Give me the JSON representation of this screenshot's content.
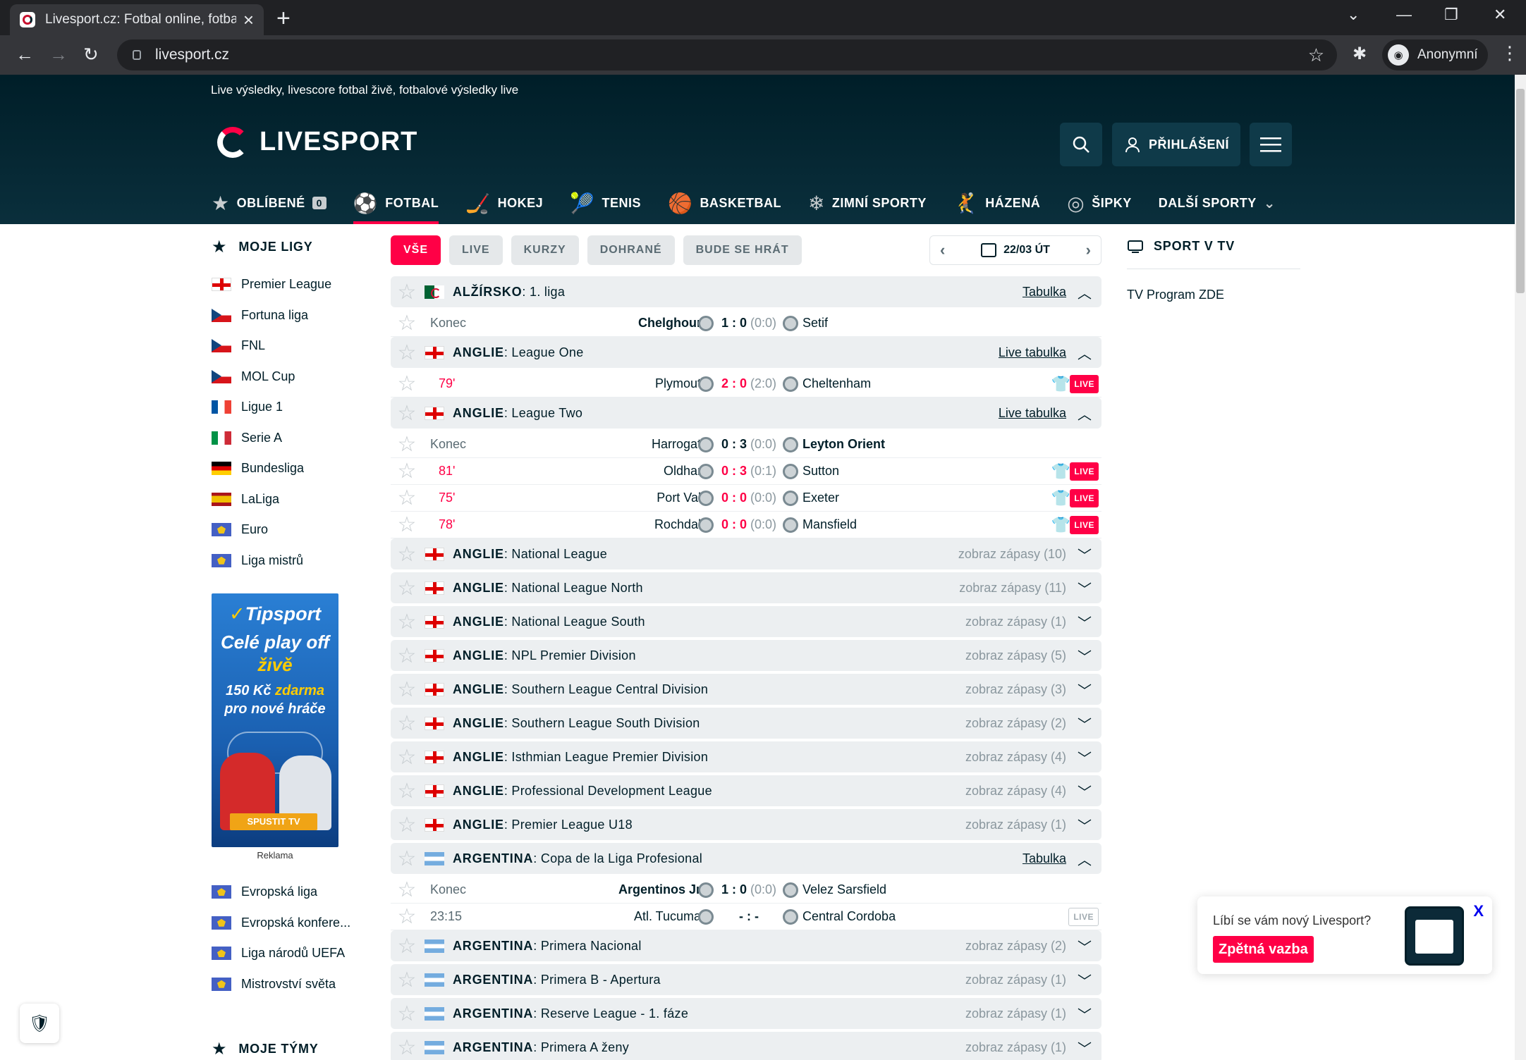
{
  "browser": {
    "tab_title": "Livesport.cz: Fotbal online, fotbal",
    "url": "livesport.cz",
    "profile": "Anonymní"
  },
  "site": {
    "tagline": "Live výsledky, livescore fotbal živě, fotbalové výsledky live",
    "logo_text": "LIVESPORT",
    "login": "PŘIHLÁŠENÍ",
    "brand_color": "#ff0046"
  },
  "sports_nav": [
    {
      "label": "OBLÍBENÉ",
      "icon": "star-icon",
      "count": "0"
    },
    {
      "label": "FOTBAL",
      "icon": "football-icon",
      "active": true
    },
    {
      "label": "HOKEJ",
      "icon": "hockey-icon"
    },
    {
      "label": "TENIS",
      "icon": "tennis-icon"
    },
    {
      "label": "BASKETBAL",
      "icon": "basketball-icon"
    },
    {
      "label": "ZIMNÍ SPORTY",
      "icon": "snowflake-icon"
    },
    {
      "label": "HÁZENÁ",
      "icon": "handball-icon"
    },
    {
      "label": "ŠIPKY",
      "icon": "darts-icon"
    },
    {
      "label": "DALŠÍ SPORTY",
      "icon": "chevron-down-icon"
    }
  ],
  "left": {
    "my_leagues_title": "MOJE LIGY",
    "leagues": [
      {
        "name": "Premier League",
        "flag": "eng"
      },
      {
        "name": "Fortuna liga",
        "flag": "cze"
      },
      {
        "name": "FNL",
        "flag": "cze"
      },
      {
        "name": "MOL Cup",
        "flag": "cze"
      },
      {
        "name": "Ligue 1",
        "flag": "fra"
      },
      {
        "name": "Serie A",
        "flag": "ita"
      },
      {
        "name": "Bundesliga",
        "flag": "ger"
      },
      {
        "name": "LaLiga",
        "flag": "esp"
      },
      {
        "name": "Euro",
        "flag": "eur"
      },
      {
        "name": "Liga mistrů",
        "flag": "eur"
      }
    ],
    "ad": {
      "brand": "Tipsport",
      "line1a": "Celé play off",
      "line1b": "živě",
      "line2a": "150 Kč",
      "line2b": "zdarma",
      "line2c": "pro nové hráče",
      "cta": "SPUSTIT TV",
      "label": "Reklama"
    },
    "more_leagues": [
      {
        "name": "Evropská liga",
        "flag": "eur"
      },
      {
        "name": "Evropská konfere...",
        "flag": "eur"
      },
      {
        "name": "Liga národů UEFA",
        "flag": "eur"
      },
      {
        "name": "Mistrovství světa",
        "flag": "eur"
      }
    ],
    "my_teams_title": "MOJE TÝMY"
  },
  "filters": {
    "items": [
      "VŠE",
      "LIVE",
      "KURZY",
      "DOHRANÉ",
      "BUDE SE HRÁT"
    ],
    "date": "22/03 ÚT"
  },
  "leagues": [
    {
      "country": "ALŽÍRSKO",
      "name": "1. liga",
      "flag": "alg",
      "right": "Tabulka",
      "right_type": "link",
      "expanded": true,
      "matches": [
        {
          "time": "Konec",
          "live": false,
          "home": "Chelghoum",
          "away": "Setif",
          "score": "1 : 0",
          "ht": "(0:0)",
          "winner": "home"
        }
      ]
    },
    {
      "country": "ANGLIE",
      "name": "League One",
      "flag": "eng",
      "right": "Live tabulka",
      "right_type": "link",
      "expanded": true,
      "matches": [
        {
          "time": "79'",
          "live": true,
          "home": "Plymouth",
          "away": "Cheltenham",
          "score": "2 : 0",
          "ht": "(2:0)",
          "badge": "LIVE"
        }
      ]
    },
    {
      "country": "ANGLIE",
      "name": "League Two",
      "flag": "eng",
      "right": "Live tabulka",
      "right_type": "link",
      "expanded": true,
      "matches": [
        {
          "time": "Konec",
          "live": false,
          "home": "Harrogate",
          "away": "Leyton Orient",
          "score": "0 : 3",
          "ht": "(0:0)",
          "winner": "away"
        },
        {
          "time": "81'",
          "live": true,
          "home": "Oldham",
          "away": "Sutton",
          "score": "0 : 3",
          "ht": "(0:1)",
          "badge": "LIVE"
        },
        {
          "time": "75'",
          "live": true,
          "home": "Port Vale",
          "away": "Exeter",
          "score": "0 : 0",
          "ht": "(0:0)",
          "badge": "LIVE"
        },
        {
          "time": "78'",
          "live": true,
          "home": "Rochdale",
          "away": "Mansfield",
          "score": "0 : 0",
          "ht": "(0:0)",
          "badge": "LIVE"
        }
      ]
    },
    {
      "country": "ANGLIE",
      "name": "National League",
      "flag": "eng",
      "right": "zobraz zápasy (10)",
      "right_type": "show"
    },
    {
      "country": "ANGLIE",
      "name": "National League North",
      "flag": "eng",
      "right": "zobraz zápasy (11)",
      "right_type": "show"
    },
    {
      "country": "ANGLIE",
      "name": "National League South",
      "flag": "eng",
      "right": "zobraz zápasy (1)",
      "right_type": "show"
    },
    {
      "country": "ANGLIE",
      "name": "NPL Premier Division",
      "flag": "eng",
      "right": "zobraz zápasy (5)",
      "right_type": "show"
    },
    {
      "country": "ANGLIE",
      "name": "Southern League Central Division",
      "flag": "eng",
      "right": "zobraz zápasy (3)",
      "right_type": "show"
    },
    {
      "country": "ANGLIE",
      "name": "Southern League South Division",
      "flag": "eng",
      "right": "zobraz zápasy (2)",
      "right_type": "show"
    },
    {
      "country": "ANGLIE",
      "name": "Isthmian League Premier Division",
      "flag": "eng",
      "right": "zobraz zápasy (4)",
      "right_type": "show"
    },
    {
      "country": "ANGLIE",
      "name": "Professional Development League",
      "flag": "eng",
      "right": "zobraz zápasy (4)",
      "right_type": "show"
    },
    {
      "country": "ANGLIE",
      "name": "Premier League U18",
      "flag": "eng",
      "right": "zobraz zápasy (1)",
      "right_type": "show"
    },
    {
      "country": "ARGENTINA",
      "name": "Copa de la Liga Profesional",
      "flag": "arg",
      "right": "Tabulka",
      "right_type": "link",
      "expanded": true,
      "matches": [
        {
          "time": "Konec",
          "live": false,
          "home": "Argentinos Jrs",
          "away": "Velez Sarsfield",
          "score": "1 : 0",
          "ht": "(0:0)",
          "winner": "home"
        },
        {
          "time": "23:15",
          "live": false,
          "home": "Atl. Tucuman",
          "away": "Central Cordoba",
          "score": "- : -",
          "ht": "",
          "badge": "LIVE",
          "badge_off": true
        }
      ]
    },
    {
      "country": "ARGENTINA",
      "name": "Primera Nacional",
      "flag": "arg",
      "right": "zobraz zápasy (2)",
      "right_type": "show"
    },
    {
      "country": "ARGENTINA",
      "name": "Primera B - Apertura",
      "flag": "arg",
      "right": "zobraz zápasy (1)",
      "right_type": "show"
    },
    {
      "country": "ARGENTINA",
      "name": "Reserve League - 1. fáze",
      "flag": "arg",
      "right": "zobraz zápasy (1)",
      "right_type": "show"
    },
    {
      "country": "ARGENTINA",
      "name": "Primera A ženy",
      "flag": "arg",
      "right": "zobraz zápasy (1)",
      "right_type": "show"
    }
  ],
  "right": {
    "title": "SPORT V TV",
    "tv_program": "TV Program ZDE"
  },
  "feedback": {
    "question": "Líbí se vám nový Livesport?",
    "button": "Zpětná vazba",
    "close": "X"
  }
}
